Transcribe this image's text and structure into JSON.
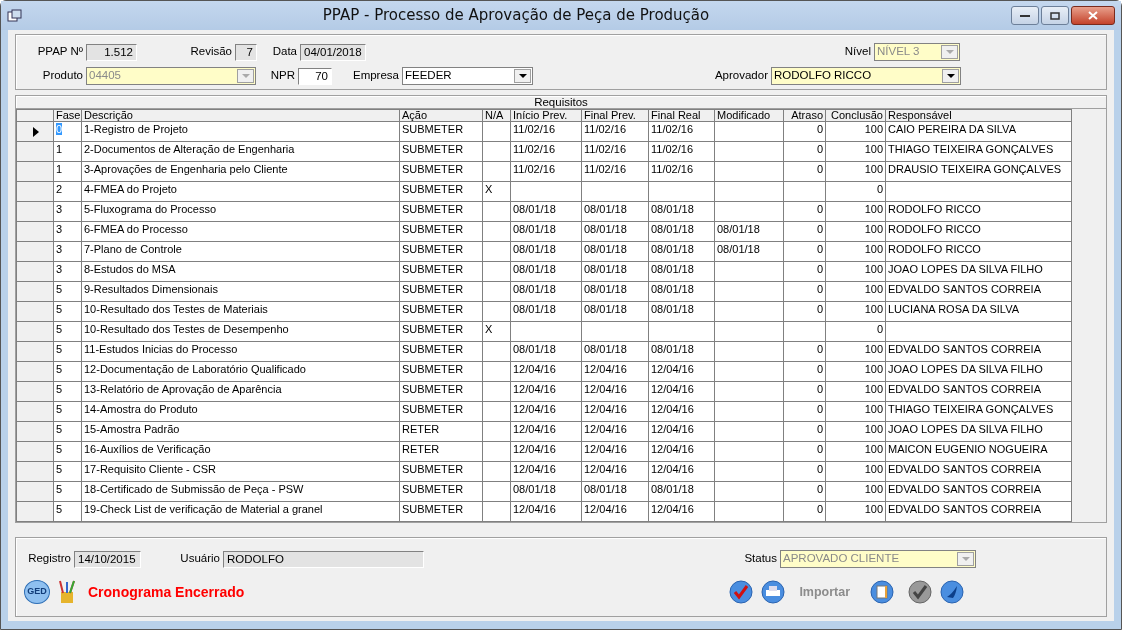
{
  "window": {
    "title": "PPAP - Processo de Aprovação de Peça de Produção"
  },
  "header": {
    "ppap_no": {
      "label": "PPAP Nº",
      "value": "1.512",
      "readonly": true
    },
    "revisao": {
      "label": "Revisão",
      "value": "7",
      "readonly": true
    },
    "data": {
      "label": "Data",
      "value": "04/01/2018",
      "readonly": true
    },
    "nivel": {
      "label": "Nível",
      "value": "NÍVEL 3",
      "disabled": true
    },
    "produto": {
      "label": "Produto",
      "value": "04405",
      "disabled": true
    },
    "npr": {
      "label": "NPR",
      "value": "70",
      "readonly": false
    },
    "empresa": {
      "label": "Empresa",
      "value": "FEEDER",
      "disabled": false
    },
    "aprovador": {
      "label": "Aprovador",
      "value": "RODOLFO RICCO",
      "disabled": false
    }
  },
  "grid": {
    "caption": "Requisitos",
    "columns": [
      "Fase",
      "Descrição",
      "Ação",
      "N/A",
      "Início Prev.",
      "Final Prev.",
      "Final Real",
      "Modificado",
      "Atraso",
      "Conclusão",
      "Responsável"
    ],
    "rows": [
      {
        "selected": true,
        "cells": [
          "0",
          "1-Registro de Projeto",
          "SUBMETER",
          "",
          "11/02/16",
          "11/02/16",
          "11/02/16",
          "",
          "0",
          "100",
          "CAIO PEREIRA DA SILVA"
        ]
      },
      {
        "selected": false,
        "cells": [
          "1",
          "2-Documentos de Alteração de Engenharia",
          "SUBMETER",
          "",
          "11/02/16",
          "11/02/16",
          "11/02/16",
          "",
          "0",
          "100",
          "THIAGO TEIXEIRA GONÇALVES"
        ]
      },
      {
        "selected": false,
        "cells": [
          "1",
          "3-Aprovações de Engenharia pelo Cliente",
          "SUBMETER",
          "",
          "11/02/16",
          "11/02/16",
          "11/02/16",
          "",
          "0",
          "100",
          "DRAUSIO TEIXEIRA GONÇALVES"
        ]
      },
      {
        "selected": false,
        "cells": [
          "2",
          "4-FMEA do Projeto",
          "SUBMETER",
          "X",
          "",
          "",
          "",
          "",
          "",
          "0",
          ""
        ]
      },
      {
        "selected": false,
        "cells": [
          "3",
          "5-Fluxograma do Processo",
          "SUBMETER",
          "",
          "08/01/18",
          "08/01/18",
          "08/01/18",
          "",
          "0",
          "100",
          "RODOLFO RICCO"
        ]
      },
      {
        "selected": false,
        "cells": [
          "3",
          "6-FMEA do Processo",
          "SUBMETER",
          "",
          "08/01/18",
          "08/01/18",
          "08/01/18",
          "08/01/18",
          "0",
          "100",
          "RODOLFO RICCO"
        ]
      },
      {
        "selected": false,
        "cells": [
          "3",
          "7-Plano de Controle",
          "SUBMETER",
          "",
          "08/01/18",
          "08/01/18",
          "08/01/18",
          "08/01/18",
          "0",
          "100",
          "RODOLFO RICCO"
        ]
      },
      {
        "selected": false,
        "cells": [
          "3",
          "8-Estudos do MSA",
          "SUBMETER",
          "",
          "08/01/18",
          "08/01/18",
          "08/01/18",
          "",
          "0",
          "100",
          "JOAO LOPES DA SILVA FILHO"
        ]
      },
      {
        "selected": false,
        "cells": [
          "5",
          "9-Resultados Dimensionais",
          "SUBMETER",
          "",
          "08/01/18",
          "08/01/18",
          "08/01/18",
          "",
          "0",
          "100",
          "EDVALDO SANTOS CORREIA"
        ]
      },
      {
        "selected": false,
        "cells": [
          "5",
          "10-Resultado dos Testes de Materiais",
          "SUBMETER",
          "",
          "08/01/18",
          "08/01/18",
          "08/01/18",
          "",
          "0",
          "100",
          "LUCIANA ROSA DA SILVA"
        ]
      },
      {
        "selected": false,
        "cells": [
          "5",
          "10-Resultado dos Testes de Desempenho",
          "SUBMETER",
          "X",
          "",
          "",
          "",
          "",
          "",
          "0",
          ""
        ]
      },
      {
        "selected": false,
        "cells": [
          "5",
          "11-Estudos Inicias do Processo",
          "SUBMETER",
          "",
          "08/01/18",
          "08/01/18",
          "08/01/18",
          "",
          "0",
          "100",
          "EDVALDO SANTOS CORREIA"
        ]
      },
      {
        "selected": false,
        "cells": [
          "5",
          "12-Documentação de Laboratório Qualificado",
          "SUBMETER",
          "",
          "12/04/16",
          "12/04/16",
          "12/04/16",
          "",
          "0",
          "100",
          "JOAO LOPES DA SILVA FILHO"
        ]
      },
      {
        "selected": false,
        "cells": [
          "5",
          "13-Relatório de Aprovação de Aparência",
          "SUBMETER",
          "",
          "12/04/16",
          "12/04/16",
          "12/04/16",
          "",
          "0",
          "100",
          "EDVALDO SANTOS CORREIA"
        ]
      },
      {
        "selected": false,
        "cells": [
          "5",
          "14-Amostra do Produto",
          "SUBMETER",
          "",
          "12/04/16",
          "12/04/16",
          "12/04/16",
          "",
          "0",
          "100",
          "THIAGO TEIXEIRA GONÇALVES"
        ]
      },
      {
        "selected": false,
        "cells": [
          "5",
          "15-Amostra Padrão",
          "RETER",
          "",
          "12/04/16",
          "12/04/16",
          "12/04/16",
          "",
          "0",
          "100",
          "JOAO LOPES DA SILVA FILHO"
        ]
      },
      {
        "selected": false,
        "cells": [
          "5",
          "16-Auxílios de Verificação",
          "RETER",
          "",
          "12/04/16",
          "12/04/16",
          "12/04/16",
          "",
          "0",
          "100",
          "MAICON EUGENIO NOGUEIRA"
        ]
      },
      {
        "selected": false,
        "cells": [
          "5",
          "17-Requisito Cliente - CSR",
          "SUBMETER",
          "",
          "12/04/16",
          "12/04/16",
          "12/04/16",
          "",
          "0",
          "100",
          "EDVALDO SANTOS CORREIA"
        ]
      },
      {
        "selected": false,
        "cells": [
          "5",
          "18-Certificado de Submissão de Peça - PSW",
          "SUBMETER",
          "",
          "08/01/18",
          "08/01/18",
          "08/01/18",
          "",
          "0",
          "100",
          "EDVALDO SANTOS CORREIA"
        ]
      },
      {
        "selected": false,
        "cells": [
          "5",
          "19-Check List de verificação de Material a granel",
          "SUBMETER",
          "",
          "12/04/16",
          "12/04/16",
          "12/04/16",
          "",
          "0",
          "100",
          "EDVALDO SANTOS CORREIA"
        ]
      }
    ]
  },
  "footer": {
    "registro": {
      "label": "Registro",
      "value": "14/10/2015",
      "readonly": true
    },
    "usuario": {
      "label": "Usuário",
      "value": "RODOLFO",
      "readonly": true
    },
    "status": {
      "label": "Status",
      "value": "APROVADO CLIENTE",
      "disabled": true
    },
    "ged_label": "GED",
    "message": "Cronograma Encerrado",
    "toolbar": [
      {
        "kind": "check",
        "disabled": false
      },
      {
        "kind": "print",
        "disabled": false
      },
      {
        "kind": "text",
        "label": "Importar",
        "disabled": true
      },
      {
        "kind": "book",
        "disabled": false
      },
      {
        "kind": "check",
        "disabled": true
      },
      {
        "kind": "exit",
        "disabled": false
      }
    ]
  }
}
